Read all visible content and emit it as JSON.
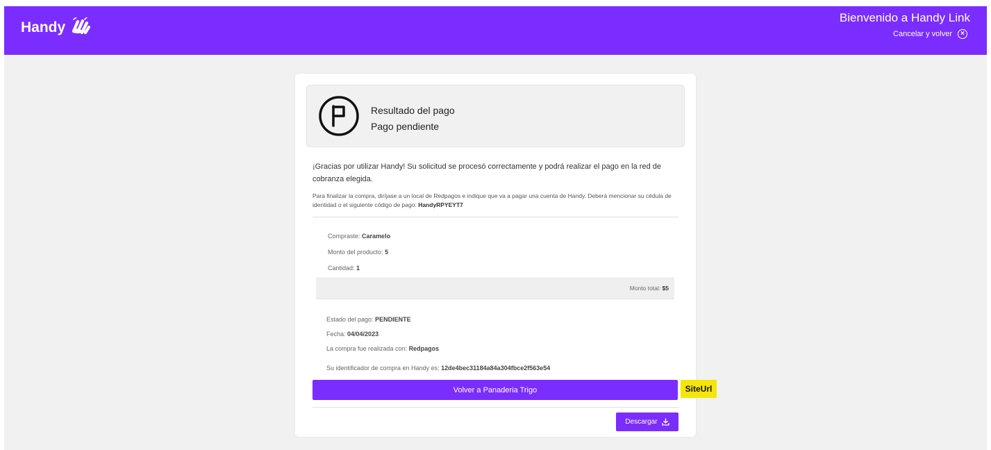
{
  "header": {
    "brand": "Handy",
    "welcome": "Bienvenido a Handy Link",
    "cancel_label": "Cancelar y volver",
    "colors": {
      "brand": "#7b2dff"
    }
  },
  "result": {
    "icon": "flag-icon",
    "title": "Resultado del pago",
    "status": "Pago pendiente"
  },
  "messages": {
    "thanks": "¡Gracias por utilizar Handy! Su solicitud se procesó correctamente y podrá realizar el pago en la red de cobranza elegida.",
    "instructions_prefix": "Para finalizar la compra, diríjase a un local de Redpagos e indique que va a pagar una cuenta de Handy. Deberá mencionar su cédula de identidad o el siguiente código de pago:",
    "payment_code": "HandyRPYEYT7"
  },
  "purchase": {
    "product_label": "Compraste:",
    "product_value": "Caramelo",
    "amount_label": "Monto del producto:",
    "amount_value": "5",
    "quantity_label": "Cantidad:",
    "quantity_value": "1",
    "total_label": "Monto total:",
    "total_value": "$5"
  },
  "status": {
    "state_label": "Estado del pago:",
    "state_value": "PENDIENTE",
    "date_label": "Fecha:",
    "date_value": "04/04/2023",
    "method_label": "La compra fue realizada con:",
    "method_value": "Redpagos",
    "id_label": "Su identificador de compra en Handy es:",
    "id_value": "12de4bec31184a84a304fbce2f563e54"
  },
  "actions": {
    "back_label": "Volver a Panaderia Trigo",
    "download_label": "Descargar",
    "annotation": "SiteUrl"
  }
}
